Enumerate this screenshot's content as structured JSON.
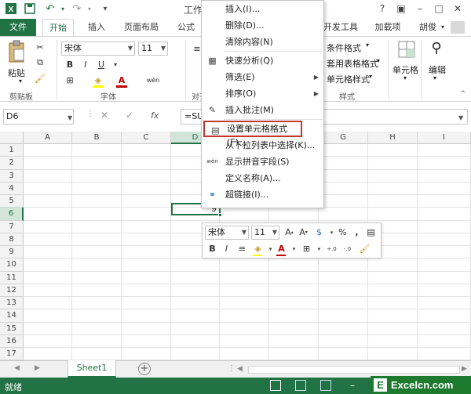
{
  "window": {
    "title": "工作"
  },
  "ribbon_tabs": [
    "文件",
    "开始",
    "插入",
    "页面布局",
    "公式",
    "开发工具",
    "加载项"
  ],
  "user": {
    "name": "胡俊"
  },
  "clipboard": {
    "paste_label": "粘贴",
    "group_label": "剪贴板"
  },
  "font_group": {
    "font_name": "宋体",
    "font_size": "11",
    "group_label": "字体",
    "bold": "B",
    "italic": "I",
    "underline": "U",
    "font_color_glyph": "A",
    "phonetic_glyph": "wén"
  },
  "align_group": {
    "group_label": "对齐"
  },
  "styles_group": {
    "conditional": "条件格式",
    "table_format": "套用表格格式",
    "cell_styles": "单元格样式",
    "group_label": "样式"
  },
  "cells_group": {
    "label": "单元格"
  },
  "edit_group": {
    "label": "编辑"
  },
  "formula_bar": {
    "name_box": "D6",
    "cancel": "✕",
    "enter": "✓",
    "fx": "fx",
    "formula": "=SUM"
  },
  "grid": {
    "columns": [
      "A",
      "B",
      "C",
      "D",
      "E",
      "F",
      "G",
      "H",
      "I"
    ],
    "rows": [
      "1",
      "2",
      "3",
      "4",
      "5",
      "6",
      "7",
      "8",
      "9",
      "10",
      "11",
      "12",
      "13",
      "14",
      "15",
      "16",
      "17"
    ],
    "active_cell_value": "9"
  },
  "context_menu": {
    "items": [
      {
        "label": "插入(I)...",
        "icon": ""
      },
      {
        "label": "删除(D)...",
        "icon": ""
      },
      {
        "label": "清除内容(N)",
        "icon": ""
      },
      {
        "label": "快速分析(Q)",
        "icon": "quick-analysis-icon"
      },
      {
        "label": "筛选(E)",
        "icon": "",
        "submenu": true
      },
      {
        "label": "排序(O)",
        "icon": "",
        "submenu": true
      },
      {
        "label": "插入批注(M)",
        "icon": "comment-icon"
      },
      {
        "label": "设置单元格格式(F)...",
        "icon": "format-cells-icon",
        "highlighted": true
      },
      {
        "label": "从下拉列表中选择(K)...",
        "icon": ""
      },
      {
        "label": "显示拼音字段(S)",
        "icon": "phonetic-icon"
      },
      {
        "label": "定义名称(A)...",
        "icon": ""
      },
      {
        "label": "超链接(I)...",
        "icon": "hyperlink-icon"
      }
    ]
  },
  "mini_toolbar": {
    "font": "宋体",
    "size": "11",
    "percent": "%",
    "comma": ",",
    "bold": "B",
    "italic": "I",
    "font_color": "A",
    "inc_decimal": ".00→.0",
    "dec_decimal": ".0→.00"
  },
  "sheets": [
    "Sheet1"
  ],
  "status": {
    "ready": "就绪"
  },
  "watermark": {
    "text": "Excelcn.com"
  },
  "colors": {
    "excel_green": "#217346",
    "highlight_border": "#c0392b",
    "watermark_bg": "#1e7a2f"
  }
}
